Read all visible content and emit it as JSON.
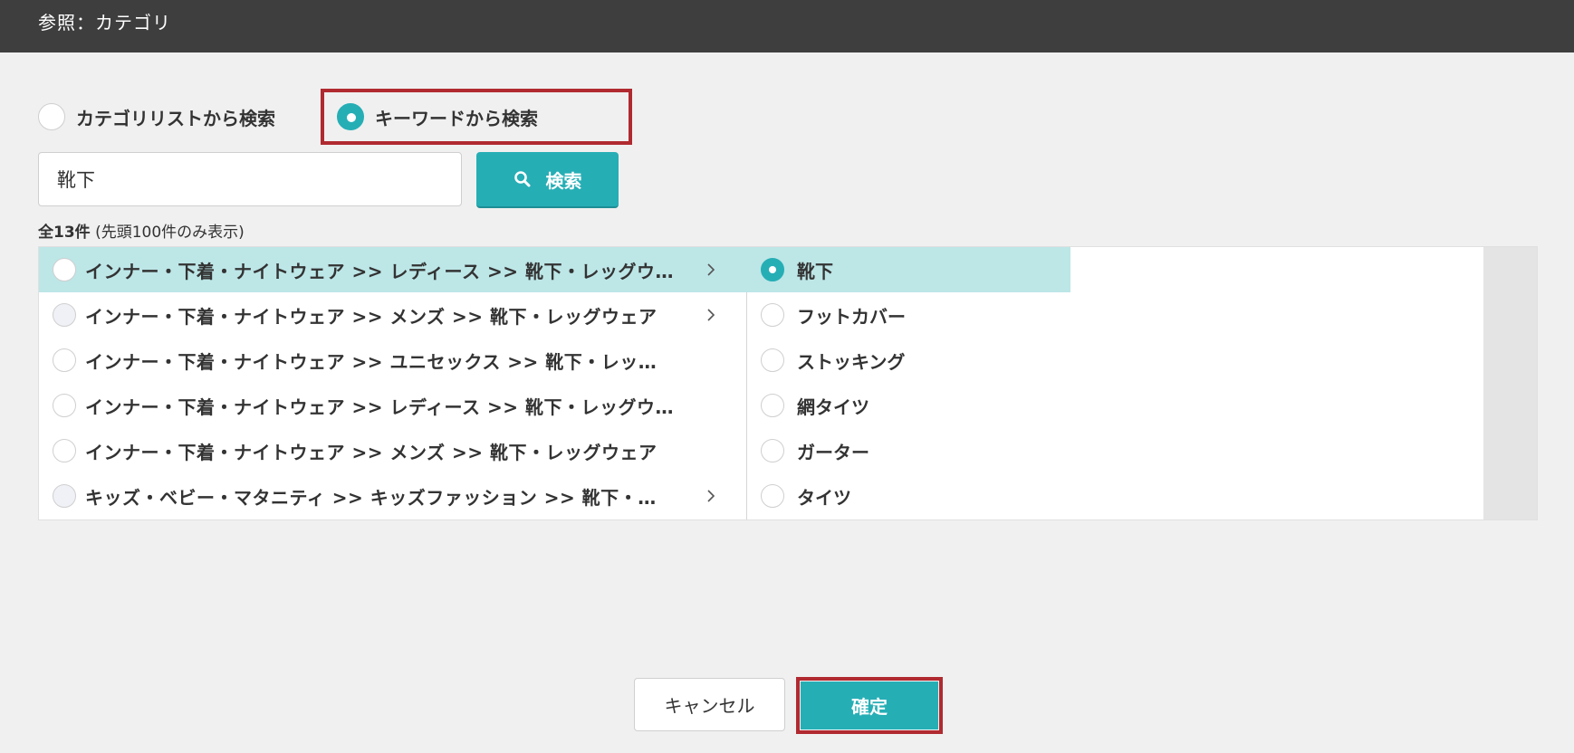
{
  "window": {
    "title": "参照：カテゴリ"
  },
  "search_mode": {
    "options": [
      {
        "label": "カテゴリリストから検索",
        "selected": false
      },
      {
        "label": "キーワードから検索",
        "selected": true
      }
    ]
  },
  "search": {
    "value": "靴下",
    "button_label": "検索"
  },
  "result_count": {
    "total": "全13件",
    "note": "(先頭100件のみ表示)"
  },
  "category_list": {
    "items": [
      {
        "label": "インナー・下着・ナイトウェア >> レディース >> 靴下・レッグウェア",
        "selected": true,
        "has_children": true
      },
      {
        "label": "インナー・下着・ナイトウェア >> メンズ >> 靴下・レッグウェア",
        "selected": false,
        "has_children": true
      },
      {
        "label": "インナー・下着・ナイトウェア >> ユニセックス >> 靴下・レッグウェア",
        "selected": false,
        "has_children": false
      },
      {
        "label": "インナー・下着・ナイトウェア >> レディース >> 靴下・レッグウェア",
        "selected": false,
        "has_children": false
      },
      {
        "label": "インナー・下着・ナイトウェア >> メンズ >> 靴下・レッグウェア",
        "selected": false,
        "has_children": false
      },
      {
        "label": "キッズ・ベビー・マタニティ >> キッズファッション >> 靴下・レッグウェア",
        "selected": false,
        "has_children": true
      }
    ]
  },
  "subcategory_list": {
    "items": [
      {
        "label": "靴下",
        "selected": true
      },
      {
        "label": "フットカバー",
        "selected": false
      },
      {
        "label": "ストッキング",
        "selected": false
      },
      {
        "label": "網タイツ",
        "selected": false
      },
      {
        "label": "ガーター",
        "selected": false
      },
      {
        "label": "タイツ",
        "selected": false
      }
    ]
  },
  "footer": {
    "cancel_label": "キャンセル",
    "confirm_label": "確定"
  },
  "colors": {
    "accent": "#26aeb5",
    "highlight": "#bde6e7",
    "annotation": "#b02a30",
    "titlebar": "#3e3e3e"
  }
}
